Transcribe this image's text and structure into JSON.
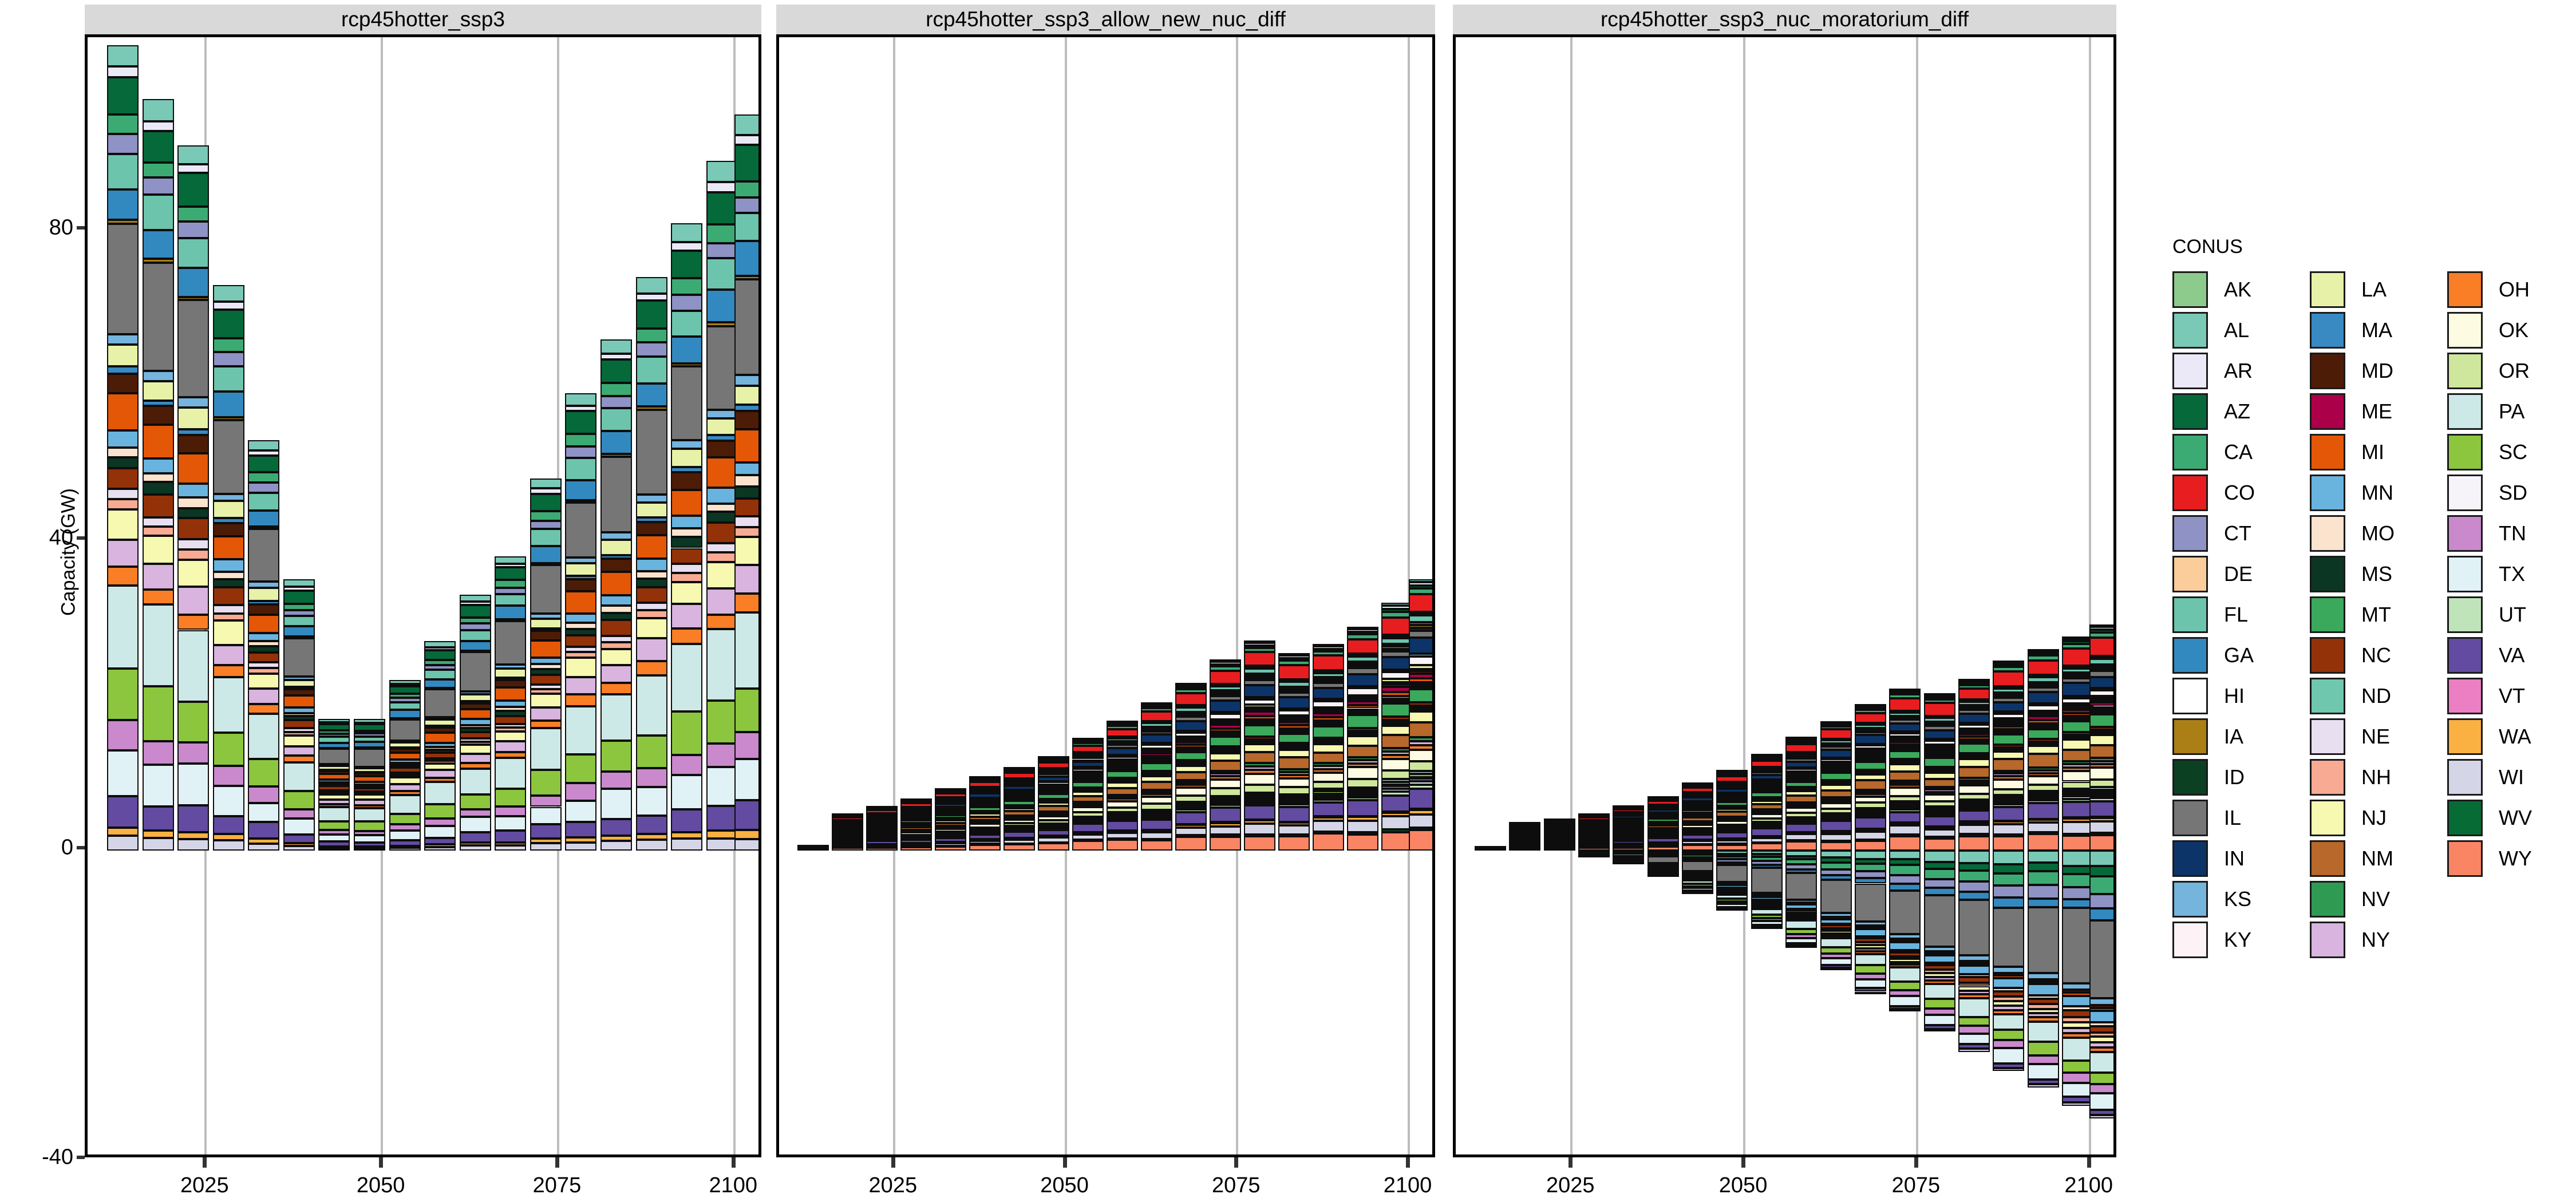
{
  "axes": {
    "ylabel": "Capacity (GW)",
    "yticks": [
      -40,
      0,
      40,
      80
    ],
    "yticklabels": [
      "-40",
      "0",
      "40",
      "80"
    ],
    "ylim": [
      -40,
      105
    ],
    "xticks": [
      2025,
      2050,
      2075,
      2100
    ],
    "xticklabels": [
      "2025",
      "2050",
      "2075",
      "2100"
    ],
    "xlim": [
      2008,
      2104
    ]
  },
  "legend": {
    "title": "CONUS",
    "columns": [
      {
        "items": [
          {
            "label": "AK",
            "color": "#8ccb8c"
          },
          {
            "label": "AL",
            "color": "#79c9b6"
          },
          {
            "label": "AR",
            "color": "#ebe9f7"
          },
          {
            "label": "AZ",
            "color": "#05693a"
          },
          {
            "label": "CA",
            "color": "#3cab73"
          },
          {
            "label": "CO",
            "color": "#e81d20"
          },
          {
            "label": "CT",
            "color": "#8e92c4"
          },
          {
            "label": "DE",
            "color": "#fbcd9a"
          },
          {
            "label": "FL",
            "color": "#6cc4ac"
          },
          {
            "label": "GA",
            "color": "#3289bf"
          },
          {
            "label": "HI",
            "color": "#ffffff"
          },
          {
            "label": "IA",
            "color": "#ab7f15"
          },
          {
            "label": "ID",
            "color": "#0b4022"
          },
          {
            "label": "IL",
            "color": "#767676"
          },
          {
            "label": "IN",
            "color": "#0d3468"
          },
          {
            "label": "KS",
            "color": "#74b4dd"
          },
          {
            "label": "KY",
            "color": "#fdf3f6"
          }
        ]
      },
      {
        "items": [
          {
            "label": "LA",
            "color": "#e7f2a8"
          },
          {
            "label": "MA",
            "color": "#3989c2"
          },
          {
            "label": "MD",
            "color": "#4d1c06"
          },
          {
            "label": "ME",
            "color": "#ab0049"
          },
          {
            "label": "MI",
            "color": "#e45707"
          },
          {
            "label": "MN",
            "color": "#69b4de"
          },
          {
            "label": "MO",
            "color": "#fce3cd"
          },
          {
            "label": "MS",
            "color": "#0b3623"
          },
          {
            "label": "MT",
            "color": "#3aa95c"
          },
          {
            "label": "NC",
            "color": "#933209"
          },
          {
            "label": "ND",
            "color": "#6fc8ae"
          },
          {
            "label": "NE",
            "color": "#e8dff0"
          },
          {
            "label": "NH",
            "color": "#f8ab92"
          },
          {
            "label": "NJ",
            "color": "#f7f9b0"
          },
          {
            "label": "NM",
            "color": "#b8682a"
          },
          {
            "label": "NV",
            "color": "#2f9b52"
          },
          {
            "label": "NY",
            "color": "#d8b4df"
          }
        ]
      },
      {
        "items": [
          {
            "label": "OH",
            "color": "#f97e26"
          },
          {
            "label": "OK",
            "color": "#fdfce2"
          },
          {
            "label": "OR",
            "color": "#cfe79c"
          },
          {
            "label": "PA",
            "color": "#cde9e7"
          },
          {
            "label": "SC",
            "color": "#8cc63e"
          },
          {
            "label": "SD",
            "color": "#f6f3f9"
          },
          {
            "label": "TN",
            "color": "#ca89cc"
          },
          {
            "label": "TX",
            "color": "#e1f2f7"
          },
          {
            "label": "UT",
            "color": "#bfe4b9"
          },
          {
            "label": "VA",
            "color": "#624ba0"
          },
          {
            "label": "VT",
            "color": "#ec7fc4"
          },
          {
            "label": "WA",
            "color": "#fbb042"
          },
          {
            "label": "WI",
            "color": "#d5d5e8"
          },
          {
            "label": "WV",
            "color": "#076b36"
          },
          {
            "label": "WY",
            "color": "#f98565"
          }
        ]
      }
    ]
  },
  "chart_data": {
    "type": "bar",
    "subtype": "stacked-bar-faceted",
    "title": "",
    "xlabel": "",
    "ylabel": "Capacity (GW)",
    "ylim": [
      -40,
      105
    ],
    "grid": "vertical-only",
    "legend_title": "CONUS",
    "legend_position": "right",
    "state_order": [
      "AK",
      "AL",
      "AR",
      "AZ",
      "CA",
      "CO",
      "CT",
      "DE",
      "FL",
      "GA",
      "HI",
      "IA",
      "ID",
      "IL",
      "IN",
      "KS",
      "KY",
      "LA",
      "MA",
      "MD",
      "ME",
      "MI",
      "MN",
      "MO",
      "MS",
      "MT",
      "NC",
      "ND",
      "NE",
      "NH",
      "NJ",
      "NM",
      "NV",
      "NY",
      "OH",
      "OK",
      "OR",
      "PA",
      "SC",
      "SD",
      "TN",
      "TX",
      "UT",
      "VA",
      "VT",
      "WA",
      "WI",
      "WV",
      "WY"
    ],
    "state_colors": {
      "AK": "#8ccb8c",
      "AL": "#79c9b6",
      "AR": "#ebe9f7",
      "AZ": "#05693a",
      "CA": "#3cab73",
      "CO": "#e81d20",
      "CT": "#8e92c4",
      "DE": "#fbcd9a",
      "FL": "#6cc4ac",
      "GA": "#3289bf",
      "HI": "#ffffff",
      "IA": "#ab7f15",
      "ID": "#0b4022",
      "IL": "#767676",
      "IN": "#0d3468",
      "KS": "#74b4dd",
      "KY": "#fdf3f6",
      "LA": "#e7f2a8",
      "MA": "#3989c2",
      "MD": "#4d1c06",
      "ME": "#ab0049",
      "MI": "#e45707",
      "MN": "#69b4de",
      "MO": "#fce3cd",
      "MS": "#0b3623",
      "MT": "#3aa95c",
      "NC": "#933209",
      "ND": "#6fc8ae",
      "NE": "#e8dff0",
      "NH": "#f8ab92",
      "NJ": "#f7f9b0",
      "NM": "#b8682a",
      "NV": "#2f9b52",
      "NY": "#d8b4df",
      "OH": "#f97e26",
      "OK": "#fdfce2",
      "OR": "#cfe79c",
      "PA": "#cde9e7",
      "SC": "#8cc63e",
      "SD": "#f6f3f9",
      "TN": "#ca89cc",
      "TX": "#e1f2f7",
      "UT": "#bfe4b9",
      "VA": "#624ba0",
      "VT": "#ec7fc4",
      "WA": "#fbb042",
      "WI": "#d5d5e8",
      "WV": "#076b36",
      "WY": "#f98565"
    },
    "x": [
      2013,
      2018,
      2023,
      2028,
      2033,
      2038,
      2043,
      2048,
      2053,
      2058,
      2063,
      2068,
      2073,
      2078,
      2083,
      2088,
      2093,
      2098,
      2102
    ],
    "panels": [
      {
        "name": "rcp45hotter_ssp3",
        "totals_positive": [
          104,
          97,
          91,
          73,
          53,
          35,
          17,
          17,
          22,
          27,
          33,
          38,
          48,
          59,
          66,
          74,
          81,
          89,
          95
        ],
        "totals_negative": [
          0,
          0,
          0,
          0,
          0,
          0,
          0,
          0,
          0,
          0,
          0,
          0,
          0,
          0,
          0,
          0,
          0,
          0,
          0
        ],
        "stacks": [
          {
            "x": 2013,
            "segments": [
              {
                "s": "AL",
                "v": 2.4
              },
              {
                "s": "AR",
                "v": 1.2
              },
              {
                "s": "AZ",
                "v": 4.2
              },
              {
                "s": "CA",
                "v": 2.2
              },
              {
                "s": "CT",
                "v": 2.1
              },
              {
                "s": "FL",
                "v": 4.1
              },
              {
                "s": "GA",
                "v": 4.0
              },
              {
                "s": "IA",
                "v": 0.5
              },
              {
                "s": "IL",
                "v": 12.5
              },
              {
                "s": "KS",
                "v": 1.2
              },
              {
                "s": "LA",
                "v": 2.6
              },
              {
                "s": "MA",
                "v": 0.7
              },
              {
                "s": "MD",
                "v": 2.3
              },
              {
                "s": "MI",
                "v": 4.1
              },
              {
                "s": "MN",
                "v": 1.9
              },
              {
                "s": "MO",
                "v": 1.3
              },
              {
                "s": "MS",
                "v": 1.4
              },
              {
                "s": "NC",
                "v": 2.6
              },
              {
                "s": "NE",
                "v": 1.3
              },
              {
                "s": "NH",
                "v": 1.3
              },
              {
                "s": "NJ",
                "v": 3.5
              },
              {
                "s": "NY",
                "v": 3.6
              },
              {
                "s": "OH",
                "v": 2.1
              },
              {
                "s": "PA",
                "v": 9.5
              },
              {
                "s": "SC",
                "v": 6.2
              },
              {
                "s": "TN",
                "v": 3.3
              },
              {
                "s": "TX",
                "v": 4.9
              },
              {
                "s": "VA",
                "v": 3.4
              },
              {
                "s": "WA",
                "v": 1.1
              },
              {
                "s": "WI",
                "v": 1.6
              }
            ]
          }
        ]
      },
      {
        "name": "rcp45hotter_ssp3_allow_new_nuc_diff",
        "totals_positive": [
          0.4,
          4.5,
          5.5,
          6.5,
          7.8,
          9.4,
          10.6,
          12.0,
          14.4,
          16.6,
          19.0,
          21.6,
          24.6,
          27.1,
          25.4,
          26.6,
          28.9,
          32.0,
          35.0
        ],
        "totals_negative": [
          0,
          0,
          0,
          0,
          0,
          0,
          0,
          0,
          0,
          0,
          0,
          0,
          0,
          0,
          0,
          0,
          0,
          0,
          0
        ]
      },
      {
        "name": "rcp45hotter_ssp3_nuc_moratorium_diff",
        "totals_positive": [
          0.3,
          3.4,
          3.9,
          4.5,
          5.6,
          6.8,
          8.6,
          10.2,
          12.3,
          14.5,
          16.6,
          18.8,
          20.8,
          20.2,
          22.1,
          24.5,
          26.0,
          27.6,
          29.2
        ],
        "totals_negative": [
          0,
          0,
          0,
          -0.6,
          -1.5,
          -3.2,
          -5.4,
          -7.6,
          -10.0,
          -12.5,
          -15.4,
          -18.5,
          -20.8,
          -23.4,
          -26.0,
          -28.5,
          -30.6,
          -33.0,
          -34.6
        ]
      }
    ]
  }
}
